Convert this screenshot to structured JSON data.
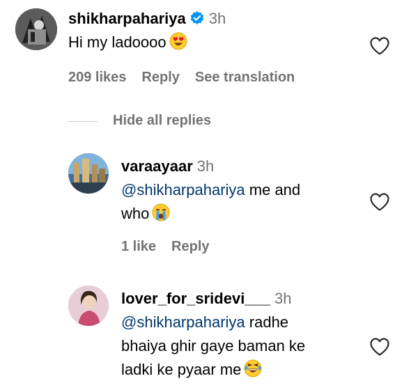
{
  "comment": {
    "username": "shikharpahariya",
    "time": "3h",
    "text": "Hi my ladoooo",
    "emoji": "heart-eyes-emoji",
    "likes": "209 likes",
    "reply_label": "Reply",
    "translate_label": "See translation"
  },
  "hide_replies_label": "Hide all replies",
  "replies": [
    {
      "username": "varaayaar",
      "time": "3h",
      "mention": "@shikharpahariya",
      "text_line1": " me and",
      "text_line2": "who",
      "emoji": "crying-emoji",
      "likes": "1 like",
      "reply_label": "Reply"
    },
    {
      "username": "lover_for_sridevi___",
      "time": "3h",
      "mention": "@shikharpahariya",
      "text_line1": " radhe",
      "text_line2": "bhaiya ghir gaye baman ke",
      "text_line3": "ladki ke pyaar me",
      "emoji": "laughing-emoji"
    }
  ],
  "colors": {
    "secondary_text": "#737373",
    "mention": "#00376b",
    "verified": "#0095f6"
  }
}
